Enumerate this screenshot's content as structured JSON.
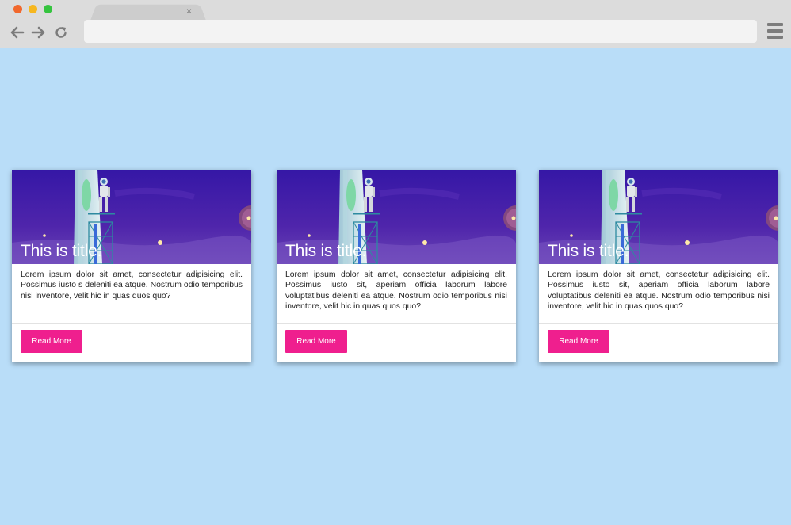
{
  "browser": {
    "tab_close": "×",
    "address": "",
    "icons": [
      "back-arrow-icon",
      "forward-arrow-icon",
      "reload-icon",
      "hamburger-menu-icon"
    ]
  },
  "cards": [
    {
      "title": "This is title.",
      "text": "Lorem ipsum dolor sit amet, consectetur adipisicing elit. Possimus iusto s deleniti ea atque. Nostrum odio temporibus nisi inventore, velit hic in quas quos quo?",
      "button": "Read More"
    },
    {
      "title": "This is title.",
      "text": "Lorem ipsum dolor sit amet, consectetur adipisicing elit. Possimus iusto sit, aperiam officia laborum labore voluptatibus deleniti ea atque. Nostrum odio temporibus nisi inventore, velit hic in quas quos quo?",
      "button": "Read More"
    },
    {
      "title": "This is title.",
      "text": "Lorem ipsum dolor sit amet, consectetur adipisicing elit. Possimus iusto sit, aperiam officia laborum labore voluptatibus deleniti ea atque. Nostrum odio temporibus nisi inventore, velit hic in quas quos quo?",
      "button": "Read More"
    }
  ],
  "colors": {
    "page_background": "#b9ddf8",
    "button": "#ef1f8e",
    "hero_top": "#3517a6",
    "hero_bottom": "#6a45b5"
  }
}
